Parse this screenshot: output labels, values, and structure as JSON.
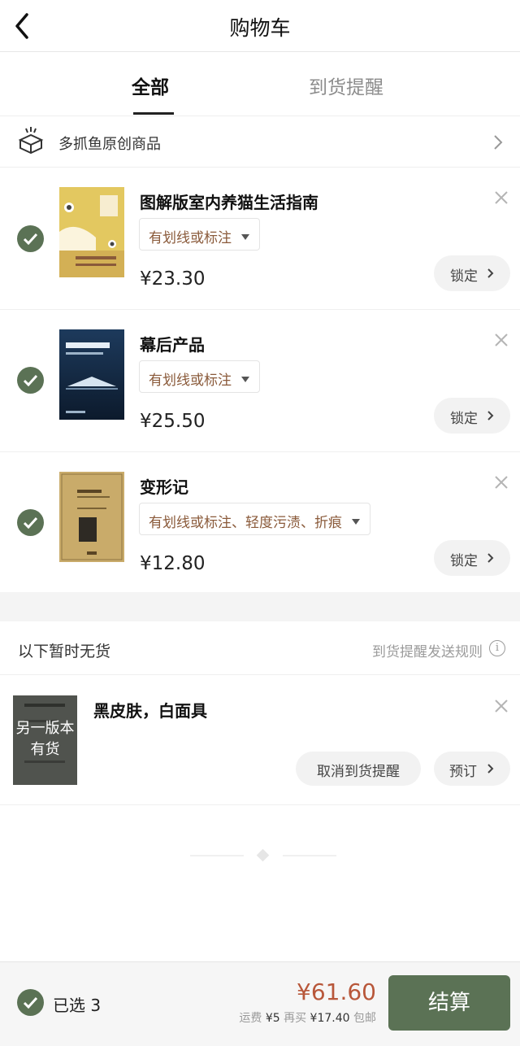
{
  "header": {
    "title": "购物车"
  },
  "tabs": [
    {
      "label": "全部",
      "active": true
    },
    {
      "label": "到货提醒",
      "active": false
    }
  ],
  "shop": {
    "name": "多抓鱼原创商品"
  },
  "cart_items": [
    {
      "title": "图解版室内养猫生活指南",
      "condition": "有划线或标注",
      "price": "¥23.30",
      "lock_label": "锁定",
      "checked": true
    },
    {
      "title": "幕后产品",
      "condition": "有划线或标注",
      "price": "¥25.50",
      "lock_label": "锁定",
      "checked": true
    },
    {
      "title": "变形记",
      "condition": "有划线或标注、轻度污渍、折痕",
      "price": "¥12.80",
      "lock_label": "锁定",
      "checked": true
    }
  ],
  "out_of_stock": {
    "heading": "以下暂时无货",
    "rule_link": "到货提醒发送规则",
    "items": [
      {
        "title": "黑皮肤，白面具",
        "cover_overlay_line1": "另一版本",
        "cover_overlay_line2": "有货",
        "cancel_label": "取消到货提醒",
        "order_label": "预订"
      }
    ]
  },
  "bottom_bar": {
    "selected_label": "已选 3",
    "total": "¥61.60",
    "shipping_prefix": "运费",
    "shipping_fee": "¥5",
    "free_ship_prefix": "再买",
    "free_ship_amount": "¥17.40",
    "free_ship_suffix": "包邮",
    "checkout_label": "结算"
  },
  "colors": {
    "accent_green": "#5b7255",
    "price_orange": "#b8573a",
    "condition_brown": "#8a5a3a"
  },
  "icons": {
    "back": "chevron-left-icon",
    "shop": "fish-box-icon",
    "close": "close-icon",
    "info": "info-icon",
    "check": "check-icon"
  }
}
